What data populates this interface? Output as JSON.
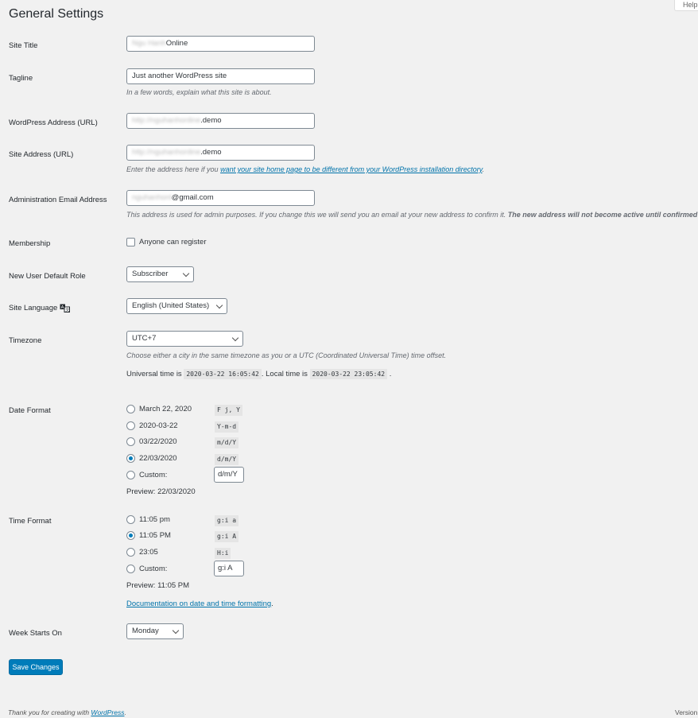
{
  "page_title": "General Settings",
  "help_label": "Help",
  "site_title": {
    "label": "Site Title",
    "value_blurred": "Ngu Hanh",
    "value_suffix": "Online"
  },
  "tagline": {
    "label": "Tagline",
    "value": "Just another WordPress site",
    "description": "In a few words, explain what this site is about."
  },
  "wp_address": {
    "label": "WordPress Address (URL)",
    "value_blurred": "http://nguhanhonline",
    "value_suffix": ".demo"
  },
  "site_address": {
    "label": "Site Address (URL)",
    "value_blurred": "http://nguhanhonline",
    "value_suffix": ".demo",
    "description_prefix": "Enter the address here if you ",
    "description_link": "want your site home page to be different from your WordPress installation directory",
    "description_suffix": "."
  },
  "admin_email": {
    "label": "Administration Email Address",
    "value_blurred": "nguhanhonl",
    "value_suffix": "@gmail.com",
    "description": "This address is used for admin purposes. If you change this we will send you an email at your new address to confirm it.",
    "description_bold": "The new address will not become active until confirmed"
  },
  "membership": {
    "label": "Membership",
    "checkbox_label": "Anyone can register",
    "checked": false
  },
  "default_role": {
    "label": "New User Default Role",
    "selected": "Subscriber"
  },
  "site_language": {
    "label": "Site Language",
    "selected": "English (United States)"
  },
  "timezone": {
    "label": "Timezone",
    "selected": "UTC+7",
    "description": "Choose either a city in the same timezone as you or a UTC (Coordinated Universal Time) time offset.",
    "universal_prefix": "Universal time is",
    "universal_time": "2020-03-22 16:05:42",
    "local_prefix": ". Local time is",
    "local_time": "2020-03-22 23:05:42",
    "local_suffix": "."
  },
  "date_format": {
    "label": "Date Format",
    "options": [
      {
        "label": "March 22, 2020",
        "code": "F j, Y",
        "checked": false
      },
      {
        "label": "2020-03-22",
        "code": "Y-m-d",
        "checked": false
      },
      {
        "label": "03/22/2020",
        "code": "m/d/Y",
        "checked": false
      },
      {
        "label": "22/03/2020",
        "code": "d/m/Y",
        "checked": true
      },
      {
        "label": "Custom:",
        "custom_value": "d/m/Y",
        "checked": false
      }
    ],
    "preview": "Preview: 22/03/2020"
  },
  "time_format": {
    "label": "Time Format",
    "options": [
      {
        "label": "11:05 pm",
        "code": "g:i a",
        "checked": false
      },
      {
        "label": "11:05 PM",
        "code": "g:i A",
        "checked": true
      },
      {
        "label": "23:05",
        "code": "H:i",
        "checked": false
      },
      {
        "label": "Custom:",
        "custom_value": "g:i A",
        "checked": false
      }
    ],
    "preview": "Preview: 11:05 PM",
    "doc_link": "Documentation on date and time formatting",
    "doc_suffix": "."
  },
  "week_start": {
    "label": "Week Starts On",
    "selected": "Monday"
  },
  "save_button": "Save Changes",
  "footer": {
    "prefix": "Thank you for creating with ",
    "link": "WordPress",
    "suffix": ".",
    "version": "Version"
  },
  "colors": {
    "accent": "#007cba",
    "link": "#0073aa",
    "background": "#f1f1f1"
  }
}
